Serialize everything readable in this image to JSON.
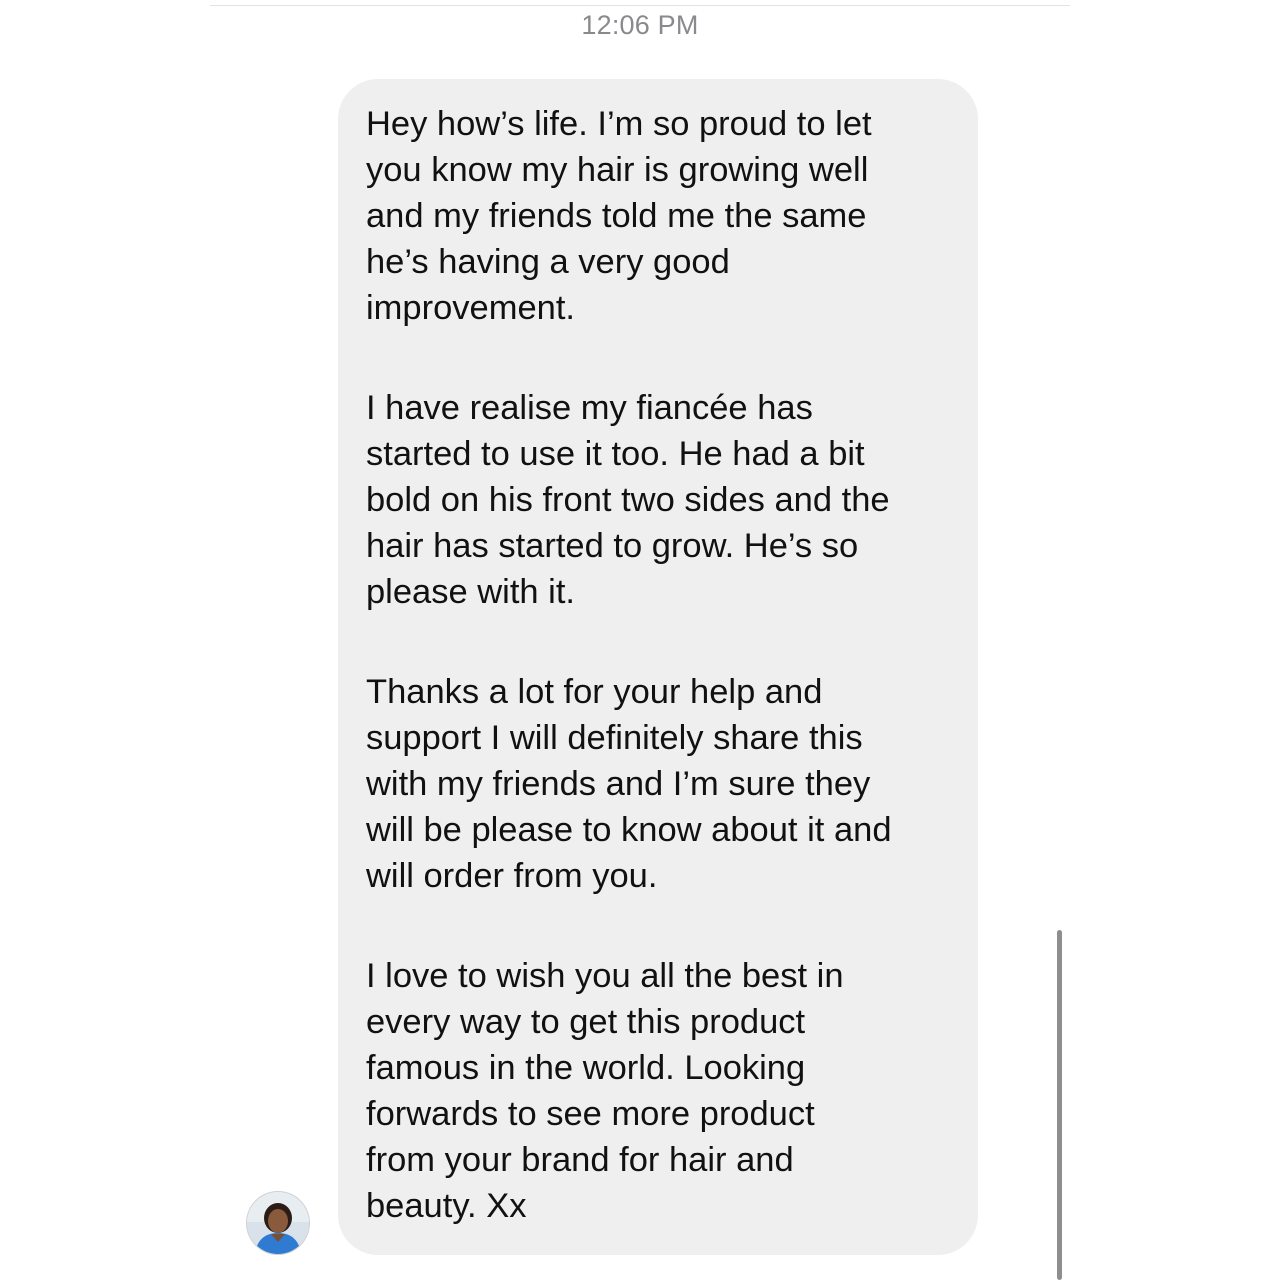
{
  "conversation": {
    "timestamp": "12:06 PM",
    "message": {
      "paragraphs": [
        "Hey how’s life. I’m so proud to let\nyou know my hair is growing well\nand my friends told me the same\nhe’s having a very good\nimprovement.",
        "I have realise my fiancée has\nstarted to use it too. He had a bit\nbold on his front two sides and the\nhair has started to grow. He’s so\nplease with it.",
        "Thanks a lot for your help and\nsupport I will definitely share this\nwith my friends and I’m sure they\nwill be please to know about it and\nwill order from you.",
        "I love to wish you all the best in\nevery way to get this product\nfamous in the world. Looking\nforwards to see more product\nfrom your brand for hair and\nbeauty. Xx"
      ]
    },
    "sender": {
      "avatar_icon": "user-avatar-photo"
    }
  },
  "colors": {
    "bubble_background": "#efefef",
    "timestamp_text": "#8a8a8e",
    "message_text": "#111111",
    "scrollbar": "#8e8e8e"
  }
}
